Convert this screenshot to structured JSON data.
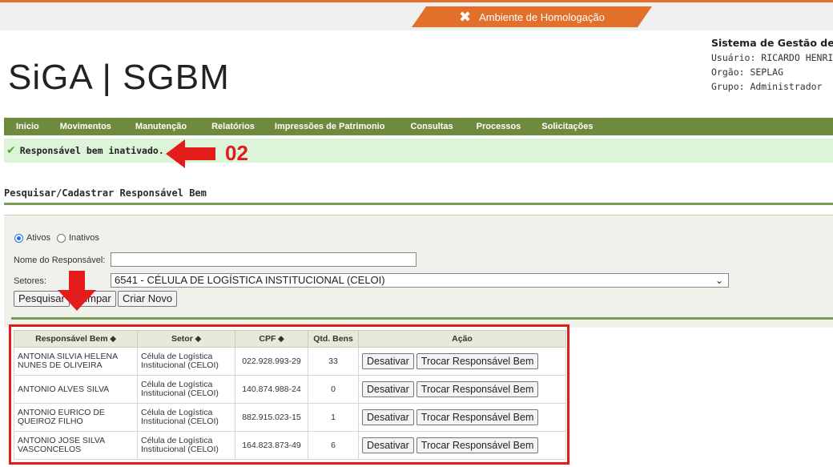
{
  "topbar": {
    "env_label": "Ambiente de Homologação",
    "icon": "tools-icon",
    "accent": "#e2702a"
  },
  "logo": {
    "text": "SiGA | SGBM"
  },
  "sysinfo": {
    "title": "Sistema de Gestão de A",
    "usuario": "Usuário: RICARDO HENRI",
    "orgao": "Orgão: SEPLAG",
    "grupo": "Grupo: Administrador"
  },
  "menu": [
    "Inicio",
    "Movimentos",
    "Manutenção",
    "Relatórios",
    "Impressões de Patrimonio",
    "Consultas",
    "Processos",
    "Solicitações"
  ],
  "message": {
    "text": "Responsável bem inativado.",
    "icon": "check-icon"
  },
  "annotations": {
    "step_number": "02",
    "color": "#e31b1b"
  },
  "section": {
    "title": "Pesquisar/Cadastrar Responsável Bem"
  },
  "filters": {
    "radio_ativos": "Ativos",
    "radio_inativos": "Inativos",
    "selected": "Ativos",
    "nome_label": "Nome do Responsável:",
    "nome_value": "",
    "setores_label": "Setores:",
    "setores_value": "6541 - CÉLULA DE LOGÍSTICA INSTITUCIONAL (CELOI)"
  },
  "buttons": {
    "pesquisar": "Pesquisar",
    "limpar": "Limpar",
    "criar_novo": "Criar Novo"
  },
  "table": {
    "headers": [
      "Responsável Bem ⬥",
      "Setor ⬥",
      "CPF ⬥",
      "Qtd. Bens",
      "Ação"
    ],
    "rows": [
      {
        "responsavel": "ANTONIA SILVIA HELENA NUNES DE OLIVEIRA",
        "setor": "Célula de Logística Institucional (CELOI)",
        "cpf": "022.928.993-29",
        "qtd": "33"
      },
      {
        "responsavel": "ANTONIO ALVES SILVA",
        "setor": "Célula de Logística Institucional (CELOI)",
        "cpf": "140.874.988-24",
        "qtd": "0"
      },
      {
        "responsavel": "ANTONIO EURICO DE QUEIROZ FILHO",
        "setor": "Célula de Logística Institucional (CELOI)",
        "cpf": "882.915.023-15",
        "qtd": "1"
      },
      {
        "responsavel": "ANTONIO JOSE SILVA VASCONCELOS",
        "setor": "Célula de Logística Institucional (CELOI)",
        "cpf": "164.823.873-49",
        "qtd": "6"
      }
    ],
    "action_desativar": "Desativar",
    "action_trocar": "Trocar Responsável Bem"
  }
}
